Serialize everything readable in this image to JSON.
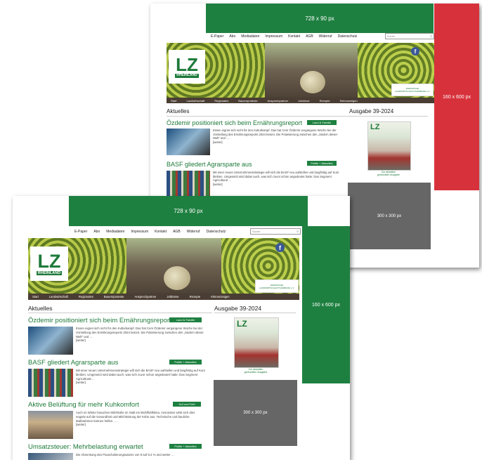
{
  "ads": {
    "leaderboard": "728 x 90 px",
    "skyscraper": "160 x 600 px",
    "rectangle": "300 x 300 px"
  },
  "nav": [
    "E-Paper",
    "Abo",
    "Mediadaten",
    "Impressum",
    "Kontakt",
    "AGB",
    "Widerruf",
    "Datenschutz"
  ],
  "search": {
    "placeholder": "Suche"
  },
  "logo": {
    "lz": "LZ",
    "region": "RHEINLAND"
  },
  "partner": {
    "label": "RHEINISCHE LANDWIRTSCHAFTSVERBAND e.V."
  },
  "categories": [
    "Start",
    "Landwirtschaft",
    "Regionales",
    "Bauernproteste",
    "Ansprechpartner",
    "Jobbörse",
    "Rezepte",
    "Kleinanzeigen"
  ],
  "section": {
    "title": "Aktuelles"
  },
  "issue": {
    "title": "Ausgabe 39-2024",
    "caption_line1": "Zur aktuellen",
    "caption_line2": "gedruckten Ausgabe"
  },
  "more": "[weiter]",
  "articles": [
    {
      "title": "Özdemir positioniert sich beim Ernährungsreport",
      "tag": "Land & Familie",
      "text": "Essen eignet sich nicht für den Kulturkampf. Das hat Cem Özdemir vergangene Woche bei der Vorstellung des Ernährungsreports 2024 betont. Die Polarisierung zwischen den „Südern dieser Welt“ und …"
    },
    {
      "title": "BASF gliedert Agrarsparte aus",
      "tag": "Politik + Aktuelles",
      "text": "Mit einer neuen Unternehmensstrategie will sich die BASF neu aufstellen und langfristig auf Kurs bleiben. Umgesetzt wird dabei auch, was sich zuvor schon angedeutet hatte: Das Segment Agricultural …"
    },
    {
      "title": "Aktive Belüftung für mehr Kuhkomfort",
      "tag": "Hof und Feld",
      "text": "Auch im Winter brauchen Milchkühe im Stall ein Wohlfühlklima. Ansonsten wirkt sich dies negativ auf die Gesundheit und Milchleistung der Kühe aus. Technische und bauliche Maßnahmen können helfen. …"
    },
    {
      "title": "Umsatzsteuer: Mehrbelastung erwartet",
      "tag": "Politik + Aktuelles",
      "text": "Die Absenkung des Pauschalierungssatzes von 9 auf 8,4 % und weiter …"
    }
  ],
  "colors": {
    "brand_green": "#1e8040",
    "ad_red": "#d7323c",
    "ad_grey": "#666666",
    "category_bar": "#4a3d33"
  }
}
